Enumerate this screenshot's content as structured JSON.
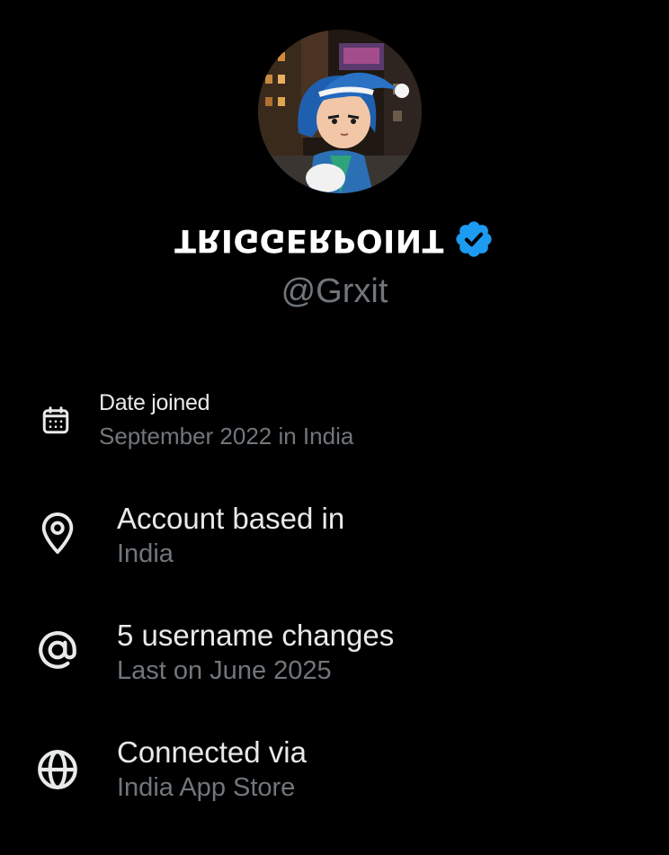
{
  "profile": {
    "display_name": "TRIGGERPOINT",
    "handle": "@Grxit",
    "verified": true,
    "verified_color": "#1d9bf0"
  },
  "about": [
    {
      "icon": "calendar-icon",
      "title": "Date joined",
      "subtitle": "September 2022 in India"
    },
    {
      "icon": "location-pin-icon",
      "title": "Account based in",
      "subtitle": "India"
    },
    {
      "icon": "at-sign-icon",
      "title": "5 username changes",
      "subtitle": "Last on June 2025"
    },
    {
      "icon": "globe-icon",
      "title": "Connected via",
      "subtitle": "India App Store"
    }
  ],
  "colors": {
    "background": "#000000",
    "primary_text": "#e7e9ea",
    "secondary_text": "#71767b"
  }
}
